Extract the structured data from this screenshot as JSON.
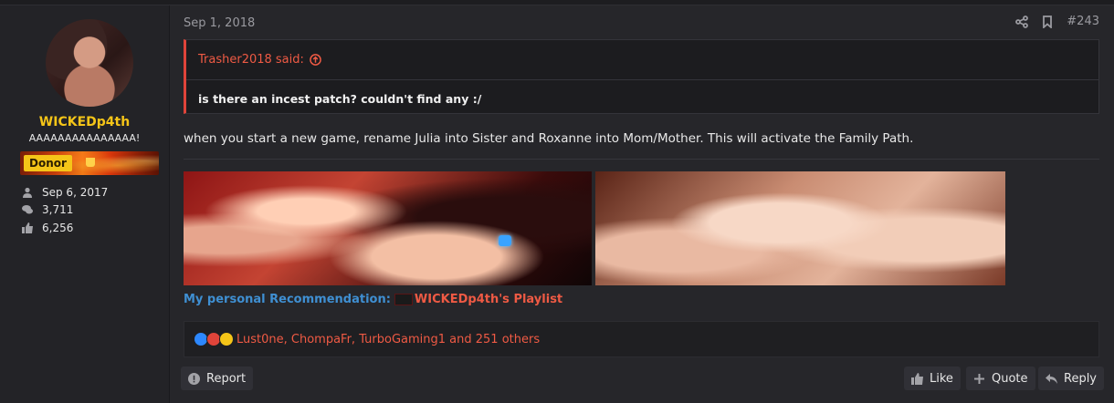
{
  "user": {
    "name": "WICKEDp4th",
    "title": "AAAAAAAAAAAAAAA!",
    "banner_label": "Donor",
    "stats": [
      {
        "icon": "user-icon",
        "value": "Sep 6, 2017"
      },
      {
        "icon": "comments-icon",
        "value": "3,711"
      },
      {
        "icon": "thumbs-up-icon",
        "value": "6,256"
      }
    ]
  },
  "post": {
    "date": "Sep 1, 2018",
    "number": "#243",
    "quote": {
      "author_line": "Trasher2018 said:",
      "text": "is there an incest patch? couldn't find any :/"
    },
    "message": "when you start a new game, rename Julia into Sister and Roxanne into Mom/Mother. This will activate the Family Path.",
    "recommend_label": "My personal Recommendation:",
    "recommend_link": "WICKEDp4th's Playlist"
  },
  "reactions": {
    "text": "Lust0ne, ChompaFr, TurboGaming1 and 251 others",
    "colors": [
      "#2d88ff",
      "#e0443a",
      "#f5c518"
    ]
  },
  "actions": {
    "report": "Report",
    "like": "Like",
    "quote": "Quote",
    "reply": "Reply"
  },
  "colors": {
    "accent": "#ef5a44",
    "username": "#f5c518",
    "link_blue": "#3f8fd2"
  }
}
